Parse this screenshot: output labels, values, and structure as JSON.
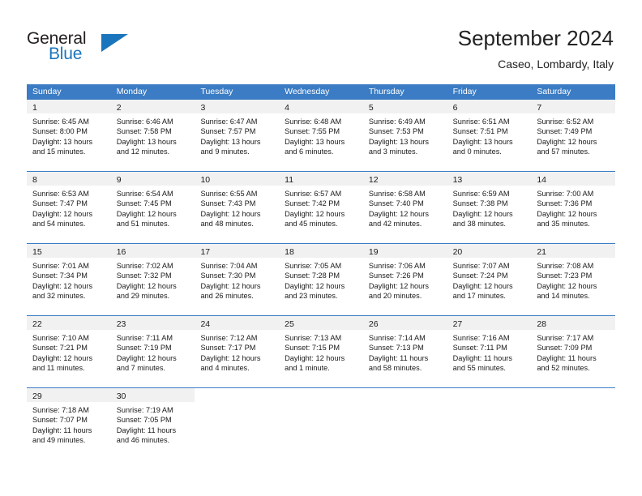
{
  "brand": {
    "name_top": "General",
    "name_bottom": "Blue",
    "color_dark": "#231f20",
    "color_blue": "#1b75bc"
  },
  "header": {
    "title": "September 2024",
    "subtitle": "Caseo, Lombardy, Italy"
  },
  "theme": {
    "header_row_bg": "#3b7cc4",
    "daynum_band_bg": "#f1f1f1",
    "grid_line": "#3b7cc4",
    "text": "#1a1a1a"
  },
  "weekdays": [
    "Sunday",
    "Monday",
    "Tuesday",
    "Wednesday",
    "Thursday",
    "Friday",
    "Saturday"
  ],
  "labels": {
    "sunrise_prefix": "Sunrise:",
    "sunset_prefix": "Sunset:",
    "daylight_prefix": "Daylight:"
  },
  "weeks": [
    [
      {
        "day": "1",
        "sunrise": "Sunrise: 6:45 AM",
        "sunset": "Sunset: 8:00 PM",
        "daylight_l1": "Daylight: 13 hours",
        "daylight_l2": "and 15 minutes."
      },
      {
        "day": "2",
        "sunrise": "Sunrise: 6:46 AM",
        "sunset": "Sunset: 7:58 PM",
        "daylight_l1": "Daylight: 13 hours",
        "daylight_l2": "and 12 minutes."
      },
      {
        "day": "3",
        "sunrise": "Sunrise: 6:47 AM",
        "sunset": "Sunset: 7:57 PM",
        "daylight_l1": "Daylight: 13 hours",
        "daylight_l2": "and 9 minutes."
      },
      {
        "day": "4",
        "sunrise": "Sunrise: 6:48 AM",
        "sunset": "Sunset: 7:55 PM",
        "daylight_l1": "Daylight: 13 hours",
        "daylight_l2": "and 6 minutes."
      },
      {
        "day": "5",
        "sunrise": "Sunrise: 6:49 AM",
        "sunset": "Sunset: 7:53 PM",
        "daylight_l1": "Daylight: 13 hours",
        "daylight_l2": "and 3 minutes."
      },
      {
        "day": "6",
        "sunrise": "Sunrise: 6:51 AM",
        "sunset": "Sunset: 7:51 PM",
        "daylight_l1": "Daylight: 13 hours",
        "daylight_l2": "and 0 minutes."
      },
      {
        "day": "7",
        "sunrise": "Sunrise: 6:52 AM",
        "sunset": "Sunset: 7:49 PM",
        "daylight_l1": "Daylight: 12 hours",
        "daylight_l2": "and 57 minutes."
      }
    ],
    [
      {
        "day": "8",
        "sunrise": "Sunrise: 6:53 AM",
        "sunset": "Sunset: 7:47 PM",
        "daylight_l1": "Daylight: 12 hours",
        "daylight_l2": "and 54 minutes."
      },
      {
        "day": "9",
        "sunrise": "Sunrise: 6:54 AM",
        "sunset": "Sunset: 7:45 PM",
        "daylight_l1": "Daylight: 12 hours",
        "daylight_l2": "and 51 minutes."
      },
      {
        "day": "10",
        "sunrise": "Sunrise: 6:55 AM",
        "sunset": "Sunset: 7:43 PM",
        "daylight_l1": "Daylight: 12 hours",
        "daylight_l2": "and 48 minutes."
      },
      {
        "day": "11",
        "sunrise": "Sunrise: 6:57 AM",
        "sunset": "Sunset: 7:42 PM",
        "daylight_l1": "Daylight: 12 hours",
        "daylight_l2": "and 45 minutes."
      },
      {
        "day": "12",
        "sunrise": "Sunrise: 6:58 AM",
        "sunset": "Sunset: 7:40 PM",
        "daylight_l1": "Daylight: 12 hours",
        "daylight_l2": "and 42 minutes."
      },
      {
        "day": "13",
        "sunrise": "Sunrise: 6:59 AM",
        "sunset": "Sunset: 7:38 PM",
        "daylight_l1": "Daylight: 12 hours",
        "daylight_l2": "and 38 minutes."
      },
      {
        "day": "14",
        "sunrise": "Sunrise: 7:00 AM",
        "sunset": "Sunset: 7:36 PM",
        "daylight_l1": "Daylight: 12 hours",
        "daylight_l2": "and 35 minutes."
      }
    ],
    [
      {
        "day": "15",
        "sunrise": "Sunrise: 7:01 AM",
        "sunset": "Sunset: 7:34 PM",
        "daylight_l1": "Daylight: 12 hours",
        "daylight_l2": "and 32 minutes."
      },
      {
        "day": "16",
        "sunrise": "Sunrise: 7:02 AM",
        "sunset": "Sunset: 7:32 PM",
        "daylight_l1": "Daylight: 12 hours",
        "daylight_l2": "and 29 minutes."
      },
      {
        "day": "17",
        "sunrise": "Sunrise: 7:04 AM",
        "sunset": "Sunset: 7:30 PM",
        "daylight_l1": "Daylight: 12 hours",
        "daylight_l2": "and 26 minutes."
      },
      {
        "day": "18",
        "sunrise": "Sunrise: 7:05 AM",
        "sunset": "Sunset: 7:28 PM",
        "daylight_l1": "Daylight: 12 hours",
        "daylight_l2": "and 23 minutes."
      },
      {
        "day": "19",
        "sunrise": "Sunrise: 7:06 AM",
        "sunset": "Sunset: 7:26 PM",
        "daylight_l1": "Daylight: 12 hours",
        "daylight_l2": "and 20 minutes."
      },
      {
        "day": "20",
        "sunrise": "Sunrise: 7:07 AM",
        "sunset": "Sunset: 7:24 PM",
        "daylight_l1": "Daylight: 12 hours",
        "daylight_l2": "and 17 minutes."
      },
      {
        "day": "21",
        "sunrise": "Sunrise: 7:08 AM",
        "sunset": "Sunset: 7:23 PM",
        "daylight_l1": "Daylight: 12 hours",
        "daylight_l2": "and 14 minutes."
      }
    ],
    [
      {
        "day": "22",
        "sunrise": "Sunrise: 7:10 AM",
        "sunset": "Sunset: 7:21 PM",
        "daylight_l1": "Daylight: 12 hours",
        "daylight_l2": "and 11 minutes."
      },
      {
        "day": "23",
        "sunrise": "Sunrise: 7:11 AM",
        "sunset": "Sunset: 7:19 PM",
        "daylight_l1": "Daylight: 12 hours",
        "daylight_l2": "and 7 minutes."
      },
      {
        "day": "24",
        "sunrise": "Sunrise: 7:12 AM",
        "sunset": "Sunset: 7:17 PM",
        "daylight_l1": "Daylight: 12 hours",
        "daylight_l2": "and 4 minutes."
      },
      {
        "day": "25",
        "sunrise": "Sunrise: 7:13 AM",
        "sunset": "Sunset: 7:15 PM",
        "daylight_l1": "Daylight: 12 hours",
        "daylight_l2": "and 1 minute."
      },
      {
        "day": "26",
        "sunrise": "Sunrise: 7:14 AM",
        "sunset": "Sunset: 7:13 PM",
        "daylight_l1": "Daylight: 11 hours",
        "daylight_l2": "and 58 minutes."
      },
      {
        "day": "27",
        "sunrise": "Sunrise: 7:16 AM",
        "sunset": "Sunset: 7:11 PM",
        "daylight_l1": "Daylight: 11 hours",
        "daylight_l2": "and 55 minutes."
      },
      {
        "day": "28",
        "sunrise": "Sunrise: 7:17 AM",
        "sunset": "Sunset: 7:09 PM",
        "daylight_l1": "Daylight: 11 hours",
        "daylight_l2": "and 52 minutes."
      }
    ],
    [
      {
        "day": "29",
        "sunrise": "Sunrise: 7:18 AM",
        "sunset": "Sunset: 7:07 PM",
        "daylight_l1": "Daylight: 11 hours",
        "daylight_l2": "and 49 minutes."
      },
      {
        "day": "30",
        "sunrise": "Sunrise: 7:19 AM",
        "sunset": "Sunset: 7:05 PM",
        "daylight_l1": "Daylight: 11 hours",
        "daylight_l2": "and 46 minutes."
      },
      {
        "day": "",
        "sunrise": "",
        "sunset": "",
        "daylight_l1": "",
        "daylight_l2": ""
      },
      {
        "day": "",
        "sunrise": "",
        "sunset": "",
        "daylight_l1": "",
        "daylight_l2": ""
      },
      {
        "day": "",
        "sunrise": "",
        "sunset": "",
        "daylight_l1": "",
        "daylight_l2": ""
      },
      {
        "day": "",
        "sunrise": "",
        "sunset": "",
        "daylight_l1": "",
        "daylight_l2": ""
      },
      {
        "day": "",
        "sunrise": "",
        "sunset": "",
        "daylight_l1": "",
        "daylight_l2": ""
      }
    ]
  ]
}
